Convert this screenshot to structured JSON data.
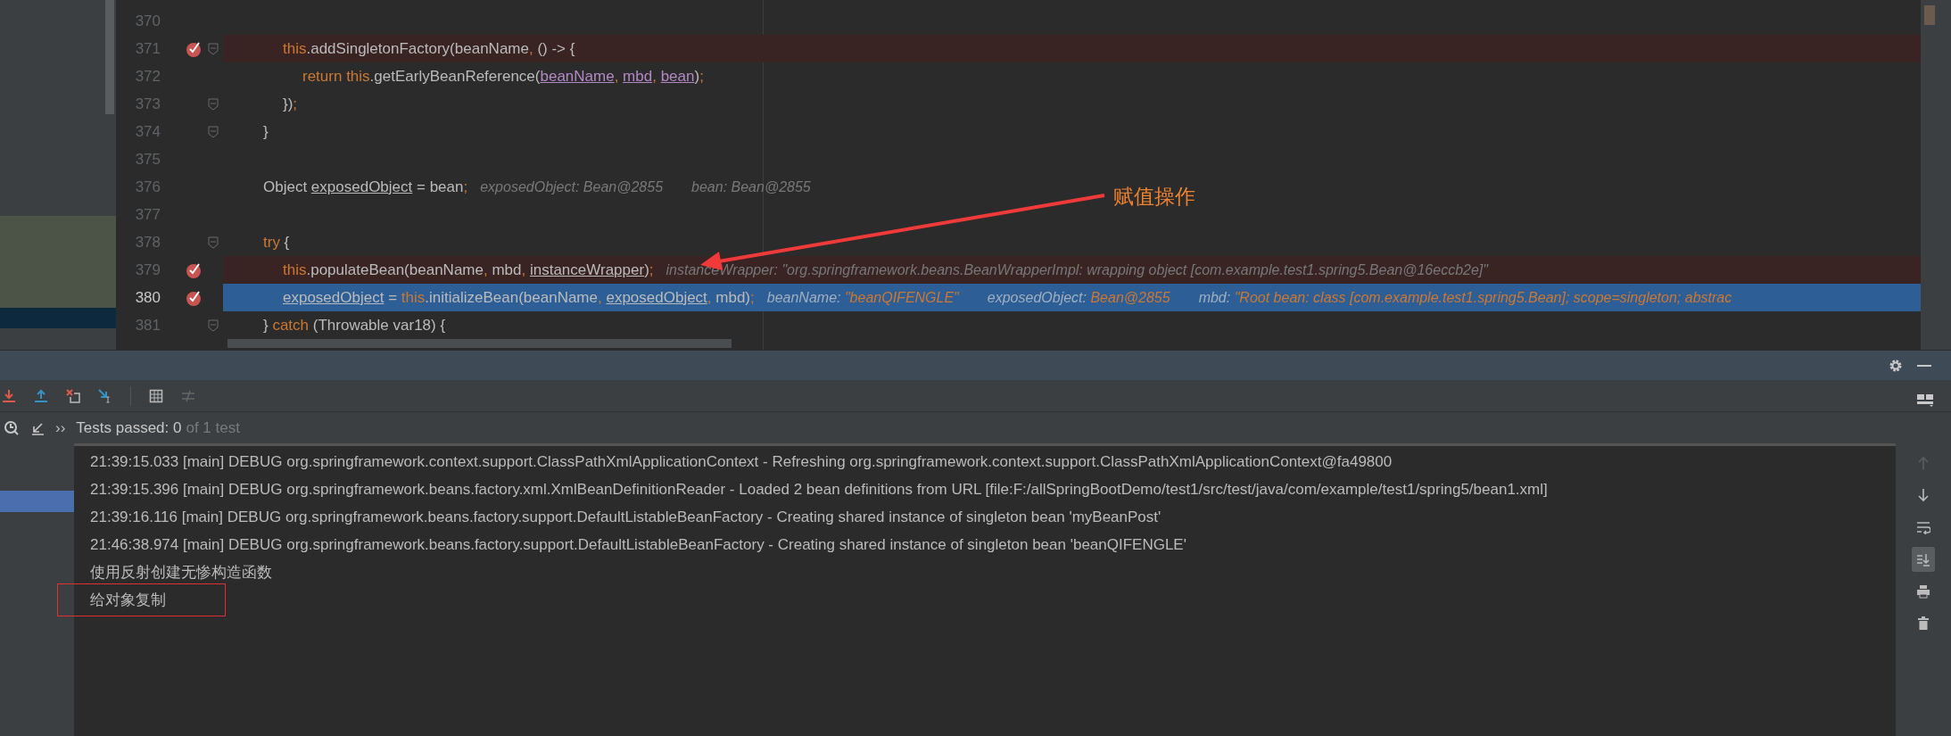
{
  "editor": {
    "code": [
      {
        "kind": "block",
        "children": [
          {
            "kind": "line",
            "number": "370",
            "breakpoint": false,
            "foldable": false,
            "current": false
          },
          {
            "kind": "line",
            "number": "371",
            "breakpoint": true,
            "foldable": true,
            "current": false,
            "tokens": [
              {
                "kind": "keyword",
                "text": "this"
              },
              {
                "kind": "text",
                "text": ".addSingletonFactory(beanName"
              },
              {
                "kind": "keyword",
                "text": ", "
              },
              {
                "kind": "text",
                "text": "() -> {"
              }
            ],
            "children": [
              {
                "kind": "line",
                "number": "372",
                "breakpoint": false,
                "foldable": false,
                "current": false,
                "tokens": [
                  {
                    "kind": "keyword",
                    "text": "return this"
                  },
                  {
                    "kind": "text",
                    "text": ".getEarlyBeanReference("
                  },
                  {
                    "kind": "param",
                    "text": "beanName"
                  },
                  {
                    "kind": "keyword",
                    "text": ", "
                  },
                  {
                    "kind": "param",
                    "text": "mbd"
                  },
                  {
                    "kind": "keyword",
                    "text": ", "
                  },
                  {
                    "kind": "param",
                    "text": "bean"
                  },
                  {
                    "kind": "text",
                    "text": ")"
                  },
                  {
                    "kind": "keyword",
                    "text": ";"
                  }
                ]
              }
            ]
          },
          {
            "kind": "line",
            "number": "373",
            "breakpoint": false,
            "foldable": true,
            "current": false,
            "tokens": [
              {
                "kind": "text",
                "text": "})"
              },
              {
                "kind": "keyword",
                "text": ";"
              }
            ]
          }
        ]
      },
      {
        "kind": "line",
        "number": "374",
        "breakpoint": false,
        "foldable": true,
        "current": false,
        "tokens": [
          {
            "kind": "text",
            "text": "}"
          }
        ]
      },
      {
        "kind": "line",
        "number": "375",
        "breakpoint": false,
        "foldable": false,
        "current": false
      },
      {
        "kind": "line",
        "number": "376",
        "breakpoint": false,
        "foldable": false,
        "current": false,
        "tokens": [
          {
            "kind": "text",
            "text": "Object "
          },
          {
            "kind": "field",
            "text": "exposedObject"
          },
          {
            "kind": "text",
            "text": " = bean"
          },
          {
            "kind": "keyword",
            "text": ";"
          }
        ],
        "hints": [
          {
            "name": "exposedObject:",
            "value": "Bean@2855"
          },
          {
            "name": "bean:",
            "value": "Bean@2855"
          }
        ]
      },
      {
        "kind": "line",
        "number": "377",
        "breakpoint": false,
        "foldable": false,
        "current": false
      },
      {
        "kind": "line",
        "number": "378",
        "breakpoint": false,
        "foldable": true,
        "current": false,
        "tokens": [
          {
            "kind": "keyword",
            "text": "try"
          },
          {
            "kind": "text",
            "text": " {"
          }
        ],
        "children": [
          {
            "kind": "line",
            "number": "379",
            "breakpoint": true,
            "foldable": false,
            "current": false,
            "tokens": [
              {
                "kind": "keyword",
                "text": "this"
              },
              {
                "kind": "text",
                "text": ".populateBean(beanName"
              },
              {
                "kind": "keyword",
                "text": ", "
              },
              {
                "kind": "text",
                "text": "mbd"
              },
              {
                "kind": "keyword",
                "text": ", "
              },
              {
                "kind": "field",
                "text": "instanceWrapper"
              },
              {
                "kind": "text",
                "text": ")"
              },
              {
                "kind": "keyword",
                "text": ";"
              }
            ],
            "hints": [
              {
                "name": "instanceWrapper:",
                "value": "\"org.springframework.beans.BeanWrapperImpl: wrapping object [com.example.test1.spring5.Bean@16eccb2e]\""
              }
            ]
          },
          {
            "kind": "line",
            "number": "380",
            "breakpoint": true,
            "foldable": false,
            "current": true,
            "tokens": [
              {
                "kind": "field",
                "text": "exposedObject"
              },
              {
                "kind": "text",
                "text": " = "
              },
              {
                "kind": "keyword",
                "text": "this"
              },
              {
                "kind": "text",
                "text": ".initializeBean(beanName"
              },
              {
                "kind": "keyword",
                "text": ", "
              },
              {
                "kind": "field",
                "text": "exposedObject"
              },
              {
                "kind": "keyword",
                "text": ", "
              },
              {
                "kind": "text",
                "text": "mbd)"
              },
              {
                "kind": "keyword",
                "text": ";"
              }
            ],
            "hints": [
              {
                "name": "beanName:",
                "value": "\"beanQIFENGLE\""
              },
              {
                "name": "exposedObject:",
                "value": "Bean@2855"
              },
              {
                "name": "mbd:",
                "value": "\"Root bean: class [com.example.test1.spring5.Bean]; scope=singleton; abstrac"
              }
            ]
          }
        ]
      },
      {
        "kind": "line",
        "number": "381",
        "breakpoint": false,
        "foldable": true,
        "current": false,
        "tokens": [
          {
            "kind": "text",
            "text": "} "
          },
          {
            "kind": "keyword",
            "text": "catch"
          },
          {
            "kind": "text",
            "text": " (Throwable var18) {"
          }
        ]
      }
    ]
  },
  "annotation": {
    "text": "赋值操作"
  },
  "run_panel": {
    "status": {
      "more": "››",
      "passed": "Tests passed: 0",
      "total": "of 1 test"
    },
    "console": [
      {
        "text": "21:39:15.033 [main] DEBUG org.springframework.context.support.ClassPathXmlApplicationContext - Refreshing org.springframework.context.support.ClassPathXmlApplicationContext@fa49800",
        "boxed": false
      },
      {
        "text": "21:39:15.396 [main] DEBUG org.springframework.beans.factory.xml.XmlBeanDefinitionReader - Loaded 2 bean definitions from URL [file:F:/allSpringBootDemo/test1/src/test/java/com/example/test1/spring5/bean1.xml]",
        "boxed": false
      },
      {
        "text": "21:39:16.116 [main] DEBUG org.springframework.beans.factory.support.DefaultListableBeanFactory - Creating shared instance of singleton bean 'myBeanPost'",
        "boxed": false
      },
      {
        "text": "21:46:38.974 [main] DEBUG org.springframework.beans.factory.support.DefaultListableBeanFactory - Creating shared instance of singleton bean 'beanQIFENGLE'",
        "boxed": false
      },
      {
        "text": "使用反射创建无惨构造函数",
        "boxed": false
      },
      {
        "text": "给对象复制",
        "boxed": true
      }
    ],
    "side_tools": [
      {
        "kind": "up",
        "disabled": true,
        "selected": false
      },
      {
        "kind": "down",
        "disabled": false,
        "selected": false
      },
      {
        "kind": "wrap",
        "disabled": false,
        "selected": false
      },
      {
        "kind": "scroll-end",
        "disabled": false,
        "selected": true
      },
      {
        "kind": "print",
        "disabled": false,
        "selected": false
      },
      {
        "kind": "trash",
        "disabled": false,
        "selected": false
      }
    ]
  }
}
